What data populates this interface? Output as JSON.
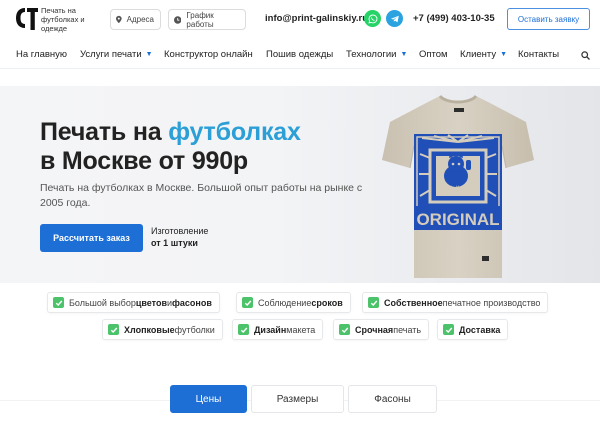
{
  "brand": {
    "tagline": "Печать на футболках и одежде"
  },
  "topbar": {
    "address": "Адреса",
    "schedule": "График работы",
    "email": "info@print-galinskiy.ru",
    "phone": "+7 (499) 403-10-35",
    "cta": "Оставить заявку"
  },
  "nav": [
    "На главную",
    "Услуги печати",
    "Конструктор онлайн",
    "Пошив одежды",
    "Технологии",
    "Оптом",
    "Клиенту",
    "Контакты"
  ],
  "hero": {
    "title_part1": "Печать на ",
    "title_accent": "футболках",
    "title_line2": "в Москве от 990р",
    "lead": "Печать на футболках в Москве. Большой опыт работы на рынке с 2005 года.",
    "cta": "Рассчитать заказ",
    "note_line1": "Изготовление",
    "note_line2": "от 1 штуки",
    "shirt_text": "ORIGINAL",
    "shirt_jp": "神を信じる"
  },
  "features": {
    "f1_a": "Большой выбор ",
    "f1_b": "цветов",
    "f1_c": " и ",
    "f1_d": "фасонов",
    "f2_a": "Соблюдение ",
    "f2_b": "сроков",
    "f3_a": "Собственное",
    "f3_b": " печатное производство",
    "f4_a": "Хлопковые",
    "f4_b": " футболки",
    "f5_a": "Дизайн",
    "f5_b": " макета",
    "f6_a": "Срочная",
    "f6_b": " печать",
    "f7_a": "Доставка"
  },
  "tabs": [
    "Цены",
    "Размеры",
    "Фасоны"
  ],
  "colors": {
    "accent": "#1d6fd6",
    "title_accent": "#2b9fd6",
    "check": "#4cc36a",
    "print_blue": "#1f4fb7",
    "shirt": "#d4ccbd"
  }
}
